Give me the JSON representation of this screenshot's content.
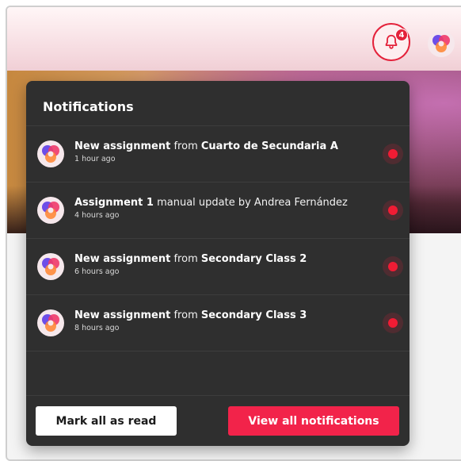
{
  "header": {
    "notifications_badge": "4"
  },
  "panel": {
    "title": "Notifications",
    "items": [
      {
        "bold1": "New assignment",
        "mid": " from ",
        "bold2": "Cuarto de Secundaria A",
        "time": "1 hour ago"
      },
      {
        "bold1": "Assignment 1",
        "mid": " manual update by Andrea Fernández",
        "bold2": "",
        "time": "4 hours ago"
      },
      {
        "bold1": "New assignment",
        "mid": " from ",
        "bold2": "Secondary Class 2",
        "time": "6 hours ago"
      },
      {
        "bold1": "New assignment",
        "mid": " from ",
        "bold2": "Secondary Class 3",
        "time": "8 hours ago"
      }
    ],
    "mark_all_label": "Mark all as read",
    "view_all_label": "View all notifications"
  },
  "colors": {
    "accent": "#f2234a",
    "unread_dot": "#f01c34",
    "panel_bg": "#2f2f2f"
  }
}
